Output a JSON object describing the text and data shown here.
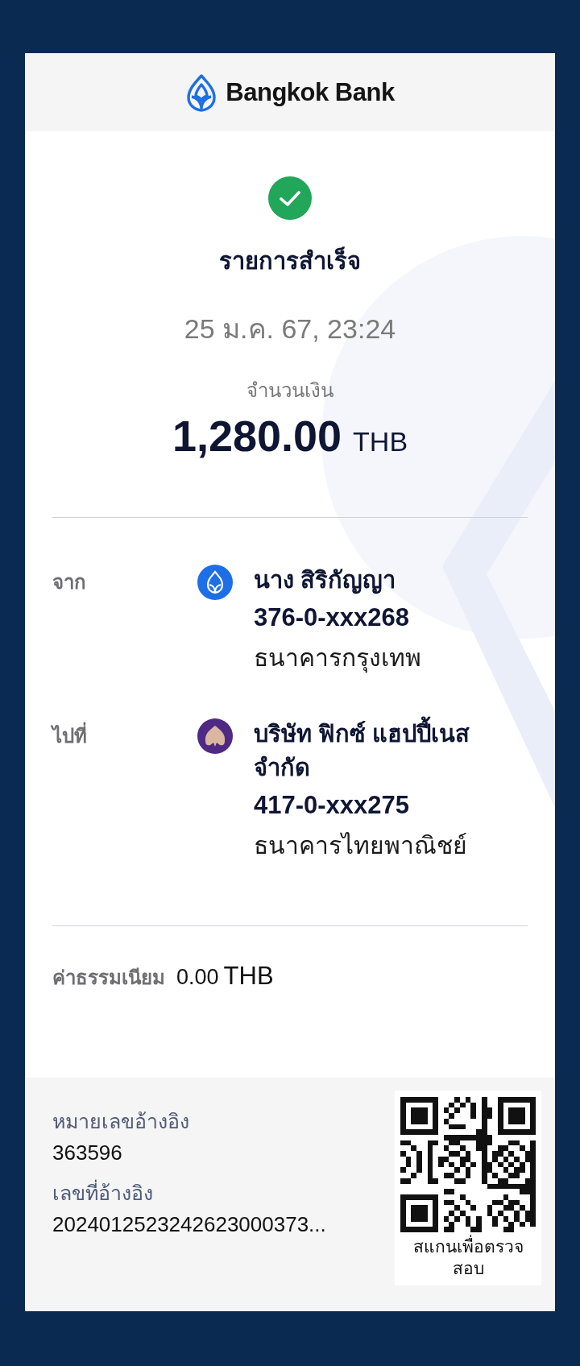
{
  "header": {
    "logo_text": "Bangkok Bank"
  },
  "status": {
    "title": "รายการสำเร็จ",
    "date": "25 ม.ค. 67, 23:24"
  },
  "amount": {
    "label": "จำนวนเงิน",
    "value": "1,280.00",
    "currency": "THB"
  },
  "parties": [
    {
      "label": "จาก",
      "kind": "leaf",
      "name": "นาง สิริกัญญา",
      "account": "376-0-xxx268",
      "bank": "ธนาคารกรุงเทพ"
    },
    {
      "label": "ไปที่",
      "kind": "shell",
      "name": "บริษัท ฟิกซ์ แฮปปี้เนส จำกัด",
      "account": "417-0-xxx275",
      "bank": "ธนาคารไทยพาณิชย์"
    }
  ],
  "fee": {
    "label": "ค่าธรรมเนียม",
    "value": "0.00",
    "currency": "THB"
  },
  "references": [
    {
      "label": "หมายเลขอ้างอิง",
      "value": "363596"
    },
    {
      "label": "เลขที่อ้างอิง",
      "value": "2024012523242623000373..."
    }
  ],
  "qr": {
    "caption": "สแกนเพื่อตรวจสอบ"
  }
}
